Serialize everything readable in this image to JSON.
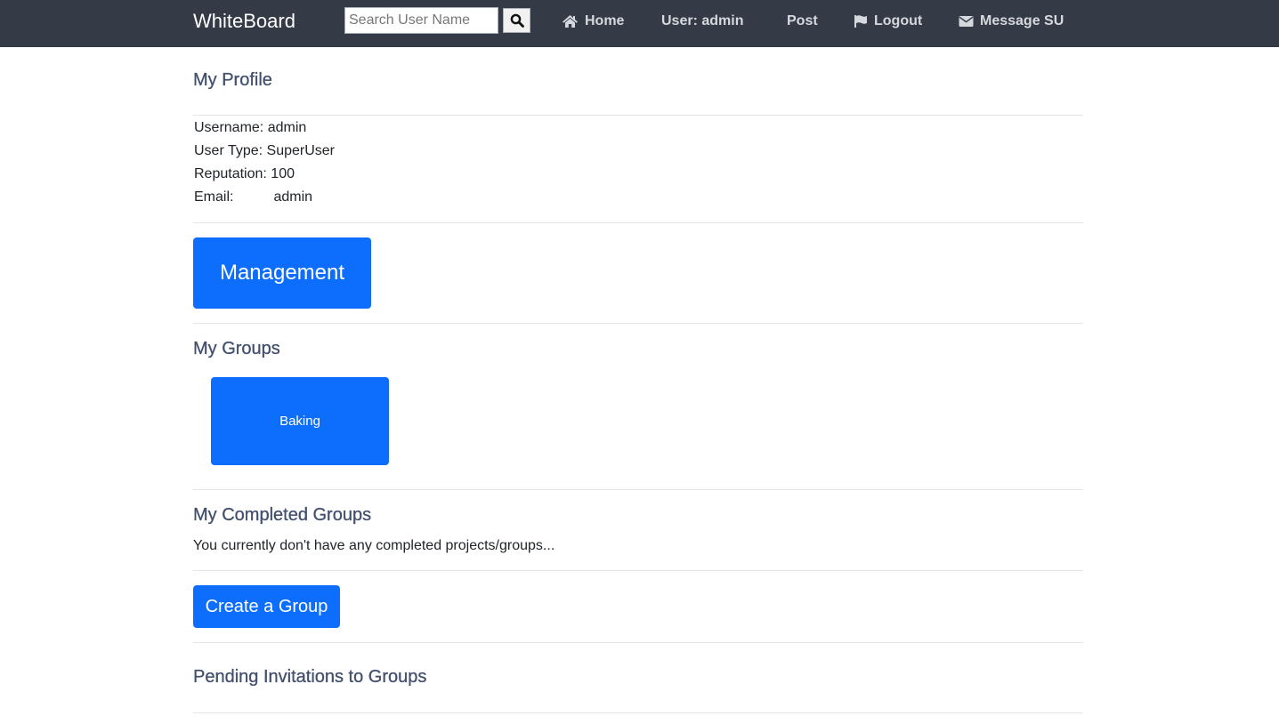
{
  "navbar": {
    "brand": "WhiteBoard",
    "search_placeholder": "Search User Name",
    "search_icon": "search-icon",
    "home_label": "Home",
    "home_icon": "home-icon",
    "user_label": "User: admin",
    "post_label": "Post",
    "logout_label": "Logout",
    "logout_icon": "flag-icon",
    "message_label": "Message SU",
    "message_icon": "envelope-icon",
    "bg_color": "#343a46"
  },
  "profile": {
    "title": "My Profile",
    "username_label": "Username:",
    "username": "admin",
    "usertype_label": "User Type:",
    "usertype": "SuperUser",
    "reputation_label": "Reputation:",
    "reputation": "100",
    "email_label": "Email:",
    "email": "admin"
  },
  "management_label": "Management",
  "groups": {
    "title": "My Groups",
    "items": [
      {
        "name": "Baking"
      }
    ]
  },
  "completed": {
    "title": "My Completed Groups",
    "empty_message": "You currently don't have any completed projects/groups..."
  },
  "create_group_label": "Create a Group",
  "pending": {
    "title": "Pending Invitations to Groups"
  },
  "accent_color": "#0d6efd"
}
